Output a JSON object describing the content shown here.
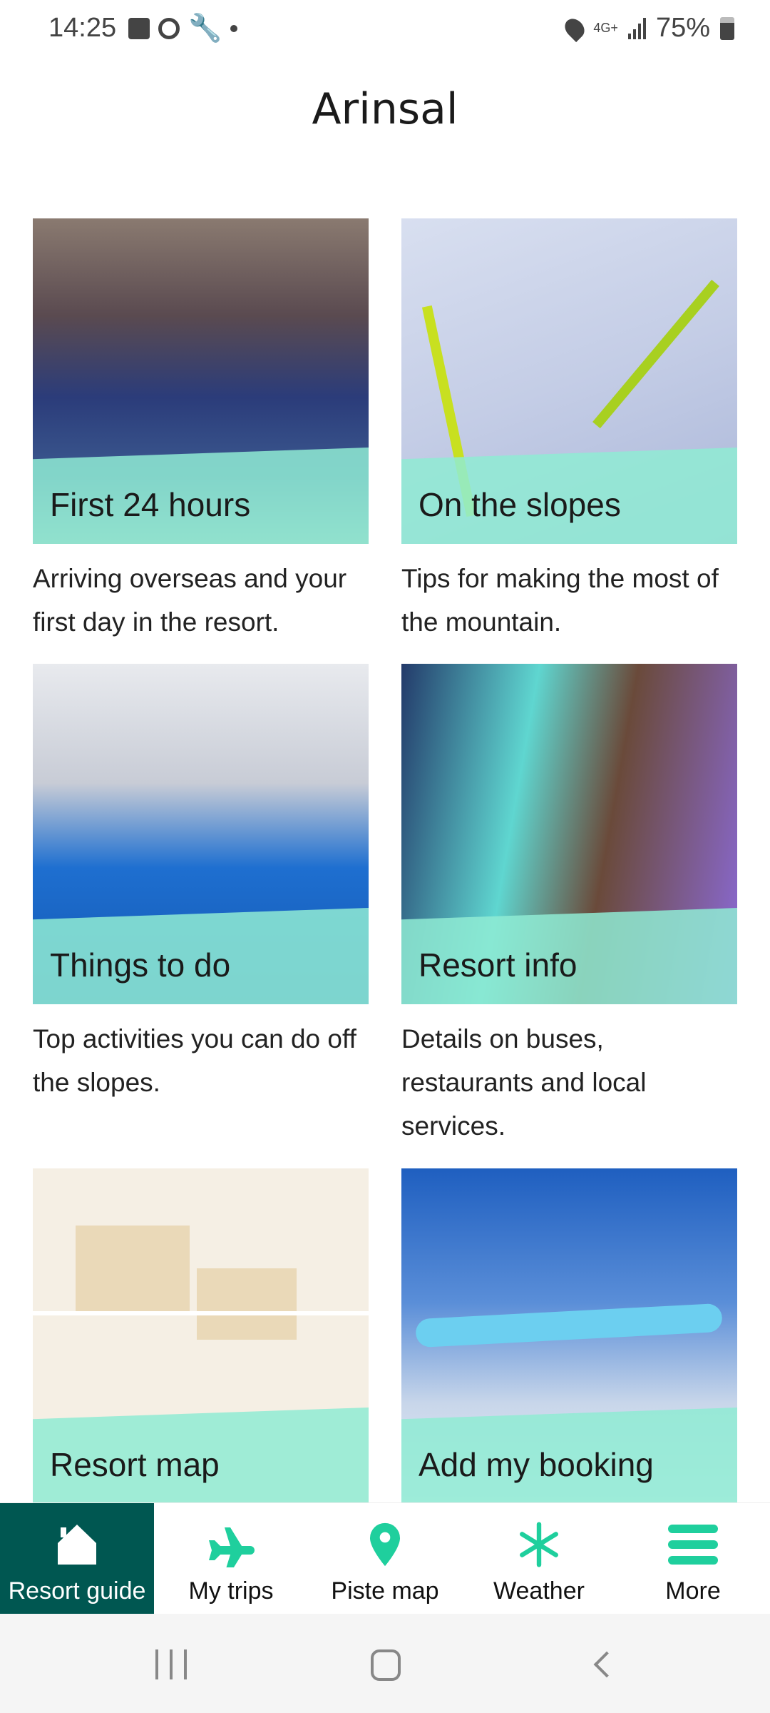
{
  "status_bar": {
    "time": "14:25",
    "battery": "75%",
    "network": "4G+"
  },
  "header": {
    "title": "Arinsal"
  },
  "cards": [
    {
      "label": "First 24 hours",
      "description": "Arriving overseas and your first day in the resort."
    },
    {
      "label": "On the slopes",
      "description": "Tips for making the most of the mountain."
    },
    {
      "label": "Things to do",
      "description": "Top activities you can do off the slopes."
    },
    {
      "label": "Resort info",
      "description": "Details on buses, restaurants and local services."
    },
    {
      "label": "Resort map",
      "description": ""
    },
    {
      "label": "Add my booking",
      "description": ""
    }
  ],
  "nav": {
    "items": [
      {
        "label": "Resort guide",
        "icon": "home-icon",
        "active": true
      },
      {
        "label": "My trips",
        "icon": "plane-icon"
      },
      {
        "label": "Piste map",
        "icon": "map-pin-icon"
      },
      {
        "label": "Weather",
        "icon": "snowflake-icon"
      },
      {
        "label": "More",
        "icon": "menu-icon"
      }
    ]
  },
  "colors": {
    "accent": "#1fcf9d",
    "active_nav": "#005751",
    "band": "#8febd4"
  }
}
